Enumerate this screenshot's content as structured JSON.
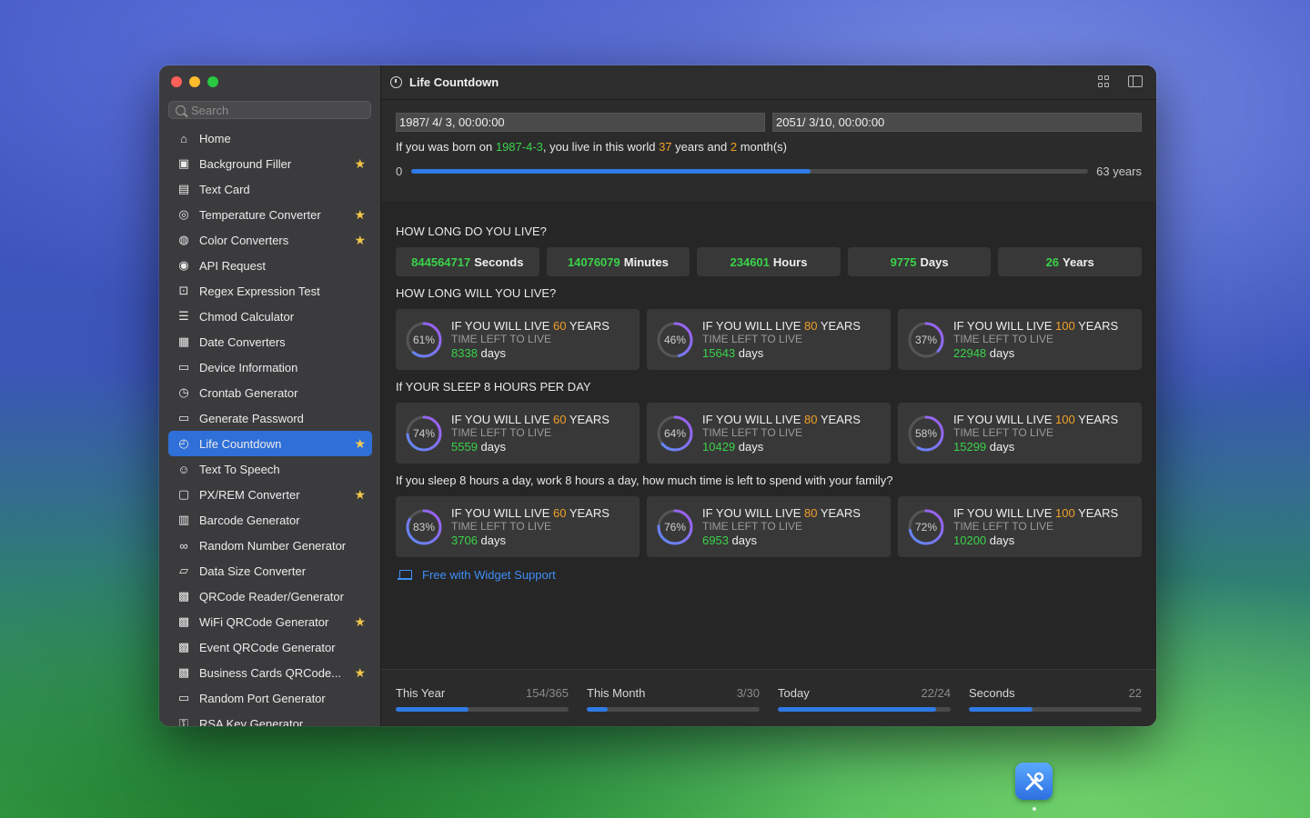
{
  "window": {
    "title": "Life Countdown"
  },
  "sidebar": {
    "search_placeholder": "Search",
    "items": [
      {
        "label": "Home",
        "icon": "house-icon",
        "starred": false,
        "active": false
      },
      {
        "label": "Background Filler",
        "icon": "photos-icon",
        "starred": true,
        "active": false
      },
      {
        "label": "Text Card",
        "icon": "photo-text-icon",
        "starred": false,
        "active": false
      },
      {
        "label": "Temperature Converter",
        "icon": "thermometer-icon",
        "starred": true,
        "active": false
      },
      {
        "label": "Color Converters",
        "icon": "palette-icon",
        "starred": true,
        "active": false
      },
      {
        "label": "API Request",
        "icon": "globe-icon",
        "starred": false,
        "active": false
      },
      {
        "label": "Regex Expression Test",
        "icon": "regex-scan-icon",
        "starred": false,
        "active": false
      },
      {
        "label": "Chmod Calculator",
        "icon": "list-doc-icon",
        "starred": false,
        "active": false
      },
      {
        "label": "Date Converters",
        "icon": "calendar-icon",
        "starred": false,
        "active": false
      },
      {
        "label": "Device Information",
        "icon": "desktop-icon",
        "starred": false,
        "active": false
      },
      {
        "label": "Crontab Generator",
        "icon": "clock-badge-icon",
        "starred": false,
        "active": false
      },
      {
        "label": "Generate Password",
        "icon": "password-dots-icon",
        "starred": false,
        "active": false
      },
      {
        "label": "Life Countdown",
        "icon": "timer-icon",
        "starred": true,
        "active": true
      },
      {
        "label": "Text To Speech",
        "icon": "person-wave-icon",
        "starred": false,
        "active": false
      },
      {
        "label": "PX/REM Converter",
        "icon": "css-shield-icon",
        "starred": true,
        "active": false
      },
      {
        "label": "Barcode Generator",
        "icon": "barcode-icon",
        "starred": false,
        "active": false
      },
      {
        "label": "Random Number Generator",
        "icon": "infinity-circle-icon",
        "starred": false,
        "active": false
      },
      {
        "label": "Data Size Converter",
        "icon": "drive-icon",
        "starred": false,
        "active": false
      },
      {
        "label": "QRCode Reader/Generator",
        "icon": "qrcode-icon",
        "starred": false,
        "active": false
      },
      {
        "label": "WiFi QRCode Generator",
        "icon": "qrcode-icon",
        "starred": true,
        "active": false
      },
      {
        "label": "Event QRCode Generator",
        "icon": "qrcode-icon",
        "starred": false,
        "active": false
      },
      {
        "label": "Business Cards QRCode...",
        "icon": "qrcode-icon",
        "starred": true,
        "active": false
      },
      {
        "label": "Random Port Generator",
        "icon": "network-port-icon",
        "starred": false,
        "active": false
      },
      {
        "label": "RSA Key Generator",
        "icon": "key-icon",
        "starred": false,
        "active": false
      }
    ]
  },
  "dates": {
    "birth": "1987/  4/  3, 00:00:00",
    "end": "2051/  3/10, 00:00:00"
  },
  "summary": {
    "prefix": "If you was born on ",
    "birth_date": "1987-4-3",
    "mid": ", you live in this world ",
    "years": "37",
    "years_word": " years and ",
    "months": "2",
    "months_word": " month(s)"
  },
  "life_progress": {
    "start": "0",
    "end": "63 years",
    "fraction": 0.59
  },
  "section1": {
    "title": "HOW LONG DO YOU LIVE?",
    "stats": [
      {
        "value": "844564717",
        "unit": "Seconds"
      },
      {
        "value": "14076079",
        "unit": "Minutes"
      },
      {
        "value": "234601",
        "unit": "Hours"
      },
      {
        "value": "9775",
        "unit": "Days"
      },
      {
        "value": "26",
        "unit": "Years"
      }
    ]
  },
  "card_labels": {
    "prefix": "IF YOU WILL LIVE ",
    "suffix": " YEARS",
    "sub": "TIME LEFT TO LIVE",
    "days": " days"
  },
  "section2": {
    "title": "HOW LONG WILL YOU LIVE?",
    "cards": [
      {
        "years": "60",
        "pct": "61%",
        "pct_value": 61,
        "days": "8338"
      },
      {
        "years": "80",
        "pct": "46%",
        "pct_value": 46,
        "days": "15643"
      },
      {
        "years": "100",
        "pct": "37%",
        "pct_value": 37,
        "days": "22948"
      }
    ]
  },
  "section3": {
    "title": "If YOUR SLEEP 8 HOURS PER DAY",
    "cards": [
      {
        "years": "60",
        "pct": "74%",
        "pct_value": 74,
        "days": "5559"
      },
      {
        "years": "80",
        "pct": "64%",
        "pct_value": 64,
        "days": "10429"
      },
      {
        "years": "100",
        "pct": "58%",
        "pct_value": 58,
        "days": "15299"
      }
    ]
  },
  "section4": {
    "title": "If you sleep 8 hours a day, work 8 hours a day, how much time is left to spend with your family?",
    "cards": [
      {
        "years": "60",
        "pct": "83%",
        "pct_value": 83,
        "days": "3706"
      },
      {
        "years": "80",
        "pct": "76%",
        "pct_value": 76,
        "days": "6953"
      },
      {
        "years": "100",
        "pct": "72%",
        "pct_value": 72,
        "days": "10200"
      }
    ]
  },
  "widget_link": "Free with Widget Support",
  "bottom": [
    {
      "label": "This Year",
      "value": "154/365",
      "fraction": 0.42
    },
    {
      "label": "This Month",
      "value": "3/30",
      "fraction": 0.12
    },
    {
      "label": "Today",
      "value": "22/24",
      "fraction": 0.917
    },
    {
      "label": "Seconds",
      "value": "22",
      "fraction": 0.37
    }
  ],
  "colors": {
    "accent": "#2f7ae5",
    "green": "#3ad24a",
    "orange": "#f0a028",
    "star": "#f0c64a",
    "ring": "#8b6cf0"
  }
}
